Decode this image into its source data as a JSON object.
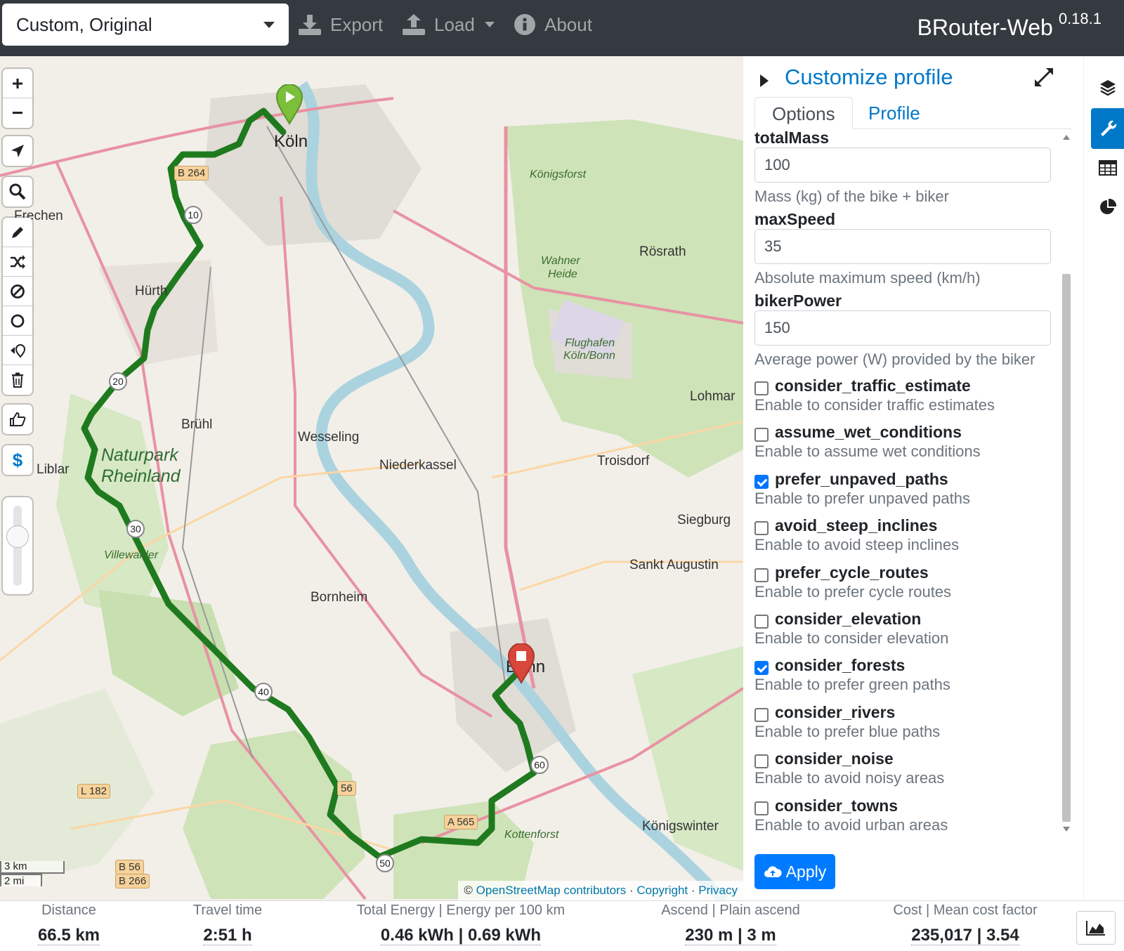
{
  "navbar": {
    "profile_select": "Custom, Original",
    "export_label": "Export",
    "load_label": "Load",
    "about_label": "About",
    "brand": "BRouter-Web",
    "version": "0.18.1"
  },
  "map": {
    "places": {
      "koeln": "Köln",
      "bonn": "Bonn",
      "frechen": "Frechen",
      "huerth": "Hürth",
      "bruehl": "Brühl",
      "wesseling": "Wesseling",
      "niederkassel": "Niederkassel",
      "troisdorf": "Troisdorf",
      "siegburg": "Siegburg",
      "sankt_augustin": "Sankt Augustin",
      "bornheim": "Bornheim",
      "liblar": "Liblar",
      "roesrath": "Rösrath",
      "lohmar": "Lohmar",
      "koenigswinter": "Königswinter",
      "koenigsforst": "Königsforst",
      "wahner_heide_1": "Wahner",
      "wahner_heide_2": "Heide",
      "flughafen_1": "Flughafen",
      "flughafen_2": "Köln/Bonn",
      "naturpark_1": "Naturpark",
      "naturpark_2": "Rheinland",
      "villewalder": "Villewalder",
      "kottenforst": "Kottenforst"
    },
    "shields": {
      "b264": "B 264",
      "a565": "A 565",
      "l182": "L 182",
      "b56": "B 56",
      "b266": "B 266",
      "a56": "56"
    },
    "km_markers": [
      "10",
      "20",
      "30",
      "40",
      "50",
      "60"
    ],
    "scale": {
      "km": "3 km",
      "mi": "2 mi"
    },
    "attribution": {
      "prefix": "©",
      "osm": "OpenStreetMap contributors",
      "sep": "·",
      "copyright": "Copyright",
      "privacy": "Privacy"
    },
    "zoom_in": "+",
    "zoom_out": "−",
    "cost_symbol": "$"
  },
  "sidebar": {
    "title": "Customize profile",
    "tabs": {
      "options": "Options",
      "profile": "Profile"
    },
    "fields": [
      {
        "label": "totalMass",
        "value": "100",
        "help": "Mass (kg) of the bike + biker"
      },
      {
        "label": "maxSpeed",
        "value": "35",
        "help": "Absolute maximum speed (km/h)"
      },
      {
        "label": "bikerPower",
        "value": "150",
        "help": "Average power (W) provided by the biker"
      }
    ],
    "checkboxes": [
      {
        "label": "consider_traffic_estimate",
        "help": "Enable to consider traffic estimates",
        "checked": false
      },
      {
        "label": "assume_wet_conditions",
        "help": "Enable to assume wet conditions",
        "checked": false
      },
      {
        "label": "prefer_unpaved_paths",
        "help": "Enable to prefer unpaved paths",
        "checked": true
      },
      {
        "label": "avoid_steep_inclines",
        "help": "Enable to avoid steep inclines",
        "checked": false
      },
      {
        "label": "prefer_cycle_routes",
        "help": "Enable to prefer cycle routes",
        "checked": false
      },
      {
        "label": "consider_elevation",
        "help": "Enable to consider elevation",
        "checked": false
      },
      {
        "label": "consider_forests",
        "help": "Enable to prefer green paths",
        "checked": true
      },
      {
        "label": "consider_rivers",
        "help": "Enable to prefer blue paths",
        "checked": false
      },
      {
        "label": "consider_noise",
        "help": "Enable to avoid noisy areas",
        "checked": false
      },
      {
        "label": "consider_towns",
        "help": "Enable to avoid urban areas",
        "checked": false
      }
    ],
    "apply_label": "Apply"
  },
  "stats": {
    "distance": {
      "label": "Distance",
      "value": "66.5 km"
    },
    "travel_time": {
      "label": "Travel time",
      "value": "2:51 h"
    },
    "energy": {
      "label": "Total Energy | Energy per 100 km",
      "value": "0.46 kWh | 0.69 kWh"
    },
    "ascend": {
      "label": "Ascend | Plain ascend",
      "value": "230 m | 3 m"
    },
    "cost": {
      "label": "Cost | Mean cost factor",
      "value": "235,017 | 3.54"
    }
  },
  "colors": {
    "navbar": "#343a40",
    "accent": "#0078c8",
    "route": "#1f7a1f",
    "start_marker": "#7bbf3a",
    "end_marker": "#d8473b",
    "primary_button": "#007bff"
  }
}
